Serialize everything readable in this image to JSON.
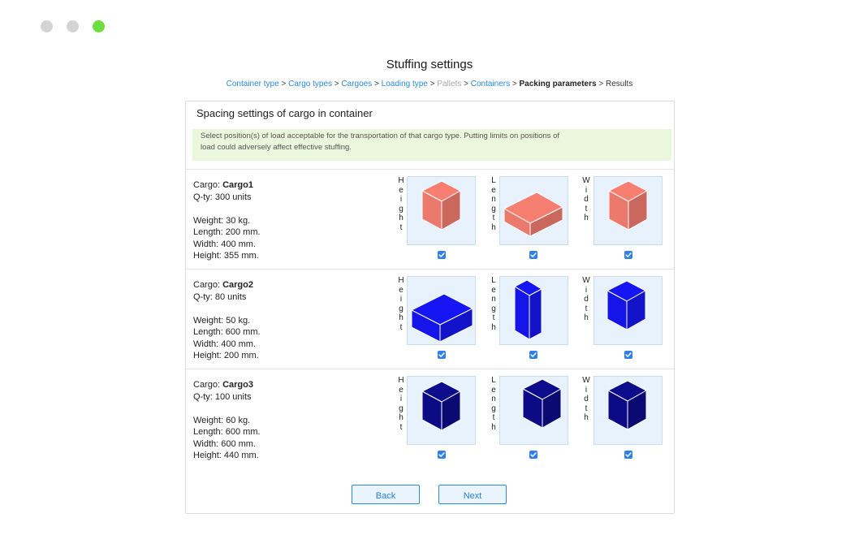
{
  "window": {
    "controls": [
      {
        "name": "close",
        "color": "#d4d4d4"
      },
      {
        "name": "minimize",
        "color": "#d4d4d4"
      },
      {
        "name": "maximize",
        "color": "#6ede3f"
      }
    ]
  },
  "page": {
    "title": "Stuffing settings"
  },
  "breadcrumb": [
    {
      "label": "Container type",
      "state": "link"
    },
    {
      "label": "Cargo types",
      "state": "link"
    },
    {
      "label": "Cargoes",
      "state": "link"
    },
    {
      "label": "Loading type",
      "state": "link"
    },
    {
      "label": "Pallets",
      "state": "disabled"
    },
    {
      "label": "Containers",
      "state": "link"
    },
    {
      "label": "Packing parameters",
      "state": "current"
    },
    {
      "label": "Results",
      "state": "plain"
    }
  ],
  "breadcrumb_separator": ">",
  "panel": {
    "heading": "Spacing settings of cargo in container",
    "note_line1": "Select position(s) of load acceptable for the transportation of that cargo type. Putting limits on positions of",
    "note_line2": "load could adversely affect effective stuffing."
  },
  "orientation_labels": [
    "Height",
    "Length",
    "Width"
  ],
  "cargo": [
    {
      "cargo_prefix": "Cargo: ",
      "name": "Cargo1",
      "qty_prefix": "Q-ty: ",
      "qty": "300 units",
      "weight": "Weight: 30 kg.",
      "length": "Length: 200 mm.",
      "width": "Width: 400 mm.",
      "height": "Height: 355 mm.",
      "color": "#f77f72",
      "orientations": [
        {
          "axis": "Height",
          "checked": true
        },
        {
          "axis": "Length",
          "checked": true
        },
        {
          "axis": "Width",
          "checked": true
        }
      ]
    },
    {
      "cargo_prefix": "Cargo: ",
      "name": "Cargo2",
      "qty_prefix": "Q-ty: ",
      "qty": "80 units",
      "weight": "Weight: 50 kg.",
      "length": "Length: 600 mm.",
      "width": "Width: 400 mm.",
      "height": "Height: 200 mm.",
      "color": "#1616f5",
      "orientations": [
        {
          "axis": "Height",
          "checked": true
        },
        {
          "axis": "Length",
          "checked": true
        },
        {
          "axis": "Width",
          "checked": true
        }
      ]
    },
    {
      "cargo_prefix": "Cargo: ",
      "name": "Cargo3",
      "qty_prefix": "Q-ty: ",
      "qty": "100 units",
      "weight": "Weight: 60 kg.",
      "length": "Length: 600 mm.",
      "width": "Width: 600 mm.",
      "height": "Height: 440 mm.",
      "color": "#0d0c8c",
      "orientations": [
        {
          "axis": "Height",
          "checked": true
        },
        {
          "axis": "Length",
          "checked": true
        },
        {
          "axis": "Width",
          "checked": true
        }
      ]
    }
  ],
  "buttons": {
    "back": "Back",
    "next": "Next"
  },
  "colors": {
    "link": "#2a8ad8",
    "checkbox": "#2f80ed",
    "note_bg": "#ebf7dc",
    "pane_bg": "#e7f2fd"
  }
}
